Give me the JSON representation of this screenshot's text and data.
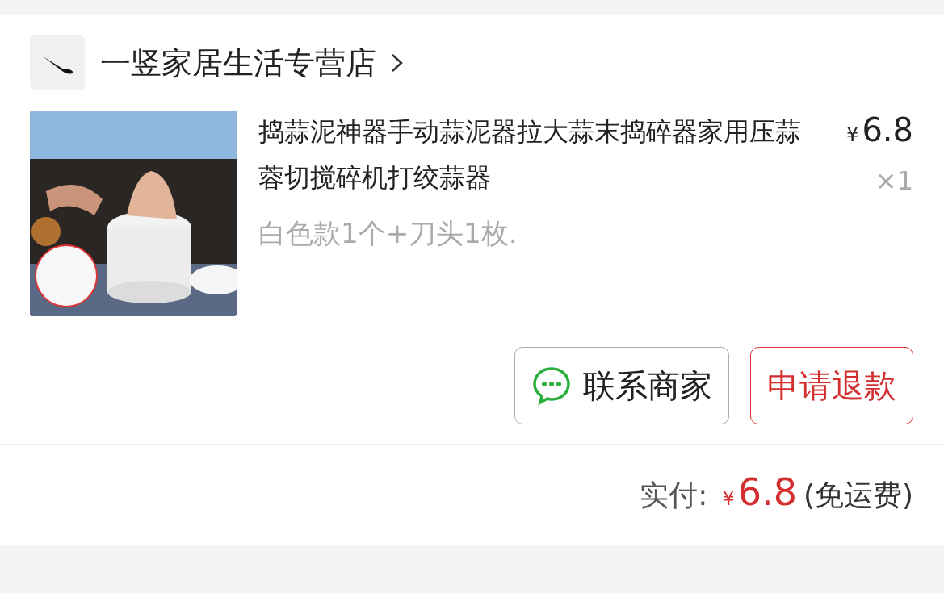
{
  "store": {
    "name": "一竖家居生活专营店"
  },
  "order_item": {
    "title": "捣蒜泥神器手动蒜泥器拉大蒜末捣碎器家用压蒜蓉切搅碎机打绞蒜器",
    "price_symbol": "¥",
    "price": "6.8",
    "quantity": "×1",
    "variant": "白色款1个+刀头1枚."
  },
  "actions": [
    {
      "label": "联系商家",
      "kind": "contact"
    },
    {
      "label": "申请退款",
      "kind": "refund"
    }
  ],
  "total": {
    "label": "实付:",
    "currency": "¥",
    "amount": "6.8",
    "note": "(免运费)"
  }
}
